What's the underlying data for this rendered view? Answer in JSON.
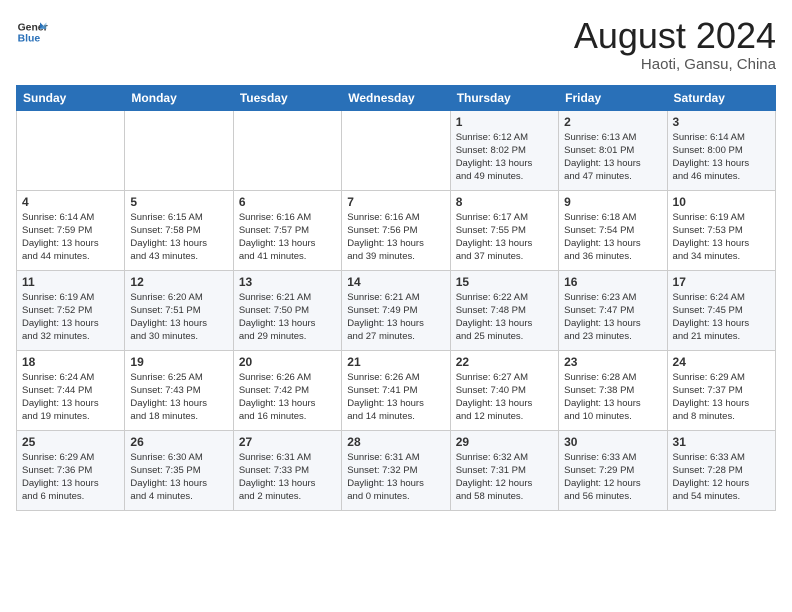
{
  "header": {
    "logo_line1": "General",
    "logo_line2": "Blue",
    "month": "August 2024",
    "location": "Haoti, Gansu, China"
  },
  "weekdays": [
    "Sunday",
    "Monday",
    "Tuesday",
    "Wednesday",
    "Thursday",
    "Friday",
    "Saturday"
  ],
  "weeks": [
    [
      {
        "day": "",
        "info": ""
      },
      {
        "day": "",
        "info": ""
      },
      {
        "day": "",
        "info": ""
      },
      {
        "day": "",
        "info": ""
      },
      {
        "day": "1",
        "info": "Sunrise: 6:12 AM\nSunset: 8:02 PM\nDaylight: 13 hours\nand 49 minutes."
      },
      {
        "day": "2",
        "info": "Sunrise: 6:13 AM\nSunset: 8:01 PM\nDaylight: 13 hours\nand 47 minutes."
      },
      {
        "day": "3",
        "info": "Sunrise: 6:14 AM\nSunset: 8:00 PM\nDaylight: 13 hours\nand 46 minutes."
      }
    ],
    [
      {
        "day": "4",
        "info": "Sunrise: 6:14 AM\nSunset: 7:59 PM\nDaylight: 13 hours\nand 44 minutes."
      },
      {
        "day": "5",
        "info": "Sunrise: 6:15 AM\nSunset: 7:58 PM\nDaylight: 13 hours\nand 43 minutes."
      },
      {
        "day": "6",
        "info": "Sunrise: 6:16 AM\nSunset: 7:57 PM\nDaylight: 13 hours\nand 41 minutes."
      },
      {
        "day": "7",
        "info": "Sunrise: 6:16 AM\nSunset: 7:56 PM\nDaylight: 13 hours\nand 39 minutes."
      },
      {
        "day": "8",
        "info": "Sunrise: 6:17 AM\nSunset: 7:55 PM\nDaylight: 13 hours\nand 37 minutes."
      },
      {
        "day": "9",
        "info": "Sunrise: 6:18 AM\nSunset: 7:54 PM\nDaylight: 13 hours\nand 36 minutes."
      },
      {
        "day": "10",
        "info": "Sunrise: 6:19 AM\nSunset: 7:53 PM\nDaylight: 13 hours\nand 34 minutes."
      }
    ],
    [
      {
        "day": "11",
        "info": "Sunrise: 6:19 AM\nSunset: 7:52 PM\nDaylight: 13 hours\nand 32 minutes."
      },
      {
        "day": "12",
        "info": "Sunrise: 6:20 AM\nSunset: 7:51 PM\nDaylight: 13 hours\nand 30 minutes."
      },
      {
        "day": "13",
        "info": "Sunrise: 6:21 AM\nSunset: 7:50 PM\nDaylight: 13 hours\nand 29 minutes."
      },
      {
        "day": "14",
        "info": "Sunrise: 6:21 AM\nSunset: 7:49 PM\nDaylight: 13 hours\nand 27 minutes."
      },
      {
        "day": "15",
        "info": "Sunrise: 6:22 AM\nSunset: 7:48 PM\nDaylight: 13 hours\nand 25 minutes."
      },
      {
        "day": "16",
        "info": "Sunrise: 6:23 AM\nSunset: 7:47 PM\nDaylight: 13 hours\nand 23 minutes."
      },
      {
        "day": "17",
        "info": "Sunrise: 6:24 AM\nSunset: 7:45 PM\nDaylight: 13 hours\nand 21 minutes."
      }
    ],
    [
      {
        "day": "18",
        "info": "Sunrise: 6:24 AM\nSunset: 7:44 PM\nDaylight: 13 hours\nand 19 minutes."
      },
      {
        "day": "19",
        "info": "Sunrise: 6:25 AM\nSunset: 7:43 PM\nDaylight: 13 hours\nand 18 minutes."
      },
      {
        "day": "20",
        "info": "Sunrise: 6:26 AM\nSunset: 7:42 PM\nDaylight: 13 hours\nand 16 minutes."
      },
      {
        "day": "21",
        "info": "Sunrise: 6:26 AM\nSunset: 7:41 PM\nDaylight: 13 hours\nand 14 minutes."
      },
      {
        "day": "22",
        "info": "Sunrise: 6:27 AM\nSunset: 7:40 PM\nDaylight: 13 hours\nand 12 minutes."
      },
      {
        "day": "23",
        "info": "Sunrise: 6:28 AM\nSunset: 7:38 PM\nDaylight: 13 hours\nand 10 minutes."
      },
      {
        "day": "24",
        "info": "Sunrise: 6:29 AM\nSunset: 7:37 PM\nDaylight: 13 hours\nand 8 minutes."
      }
    ],
    [
      {
        "day": "25",
        "info": "Sunrise: 6:29 AM\nSunset: 7:36 PM\nDaylight: 13 hours\nand 6 minutes."
      },
      {
        "day": "26",
        "info": "Sunrise: 6:30 AM\nSunset: 7:35 PM\nDaylight: 13 hours\nand 4 minutes."
      },
      {
        "day": "27",
        "info": "Sunrise: 6:31 AM\nSunset: 7:33 PM\nDaylight: 13 hours\nand 2 minutes."
      },
      {
        "day": "28",
        "info": "Sunrise: 6:31 AM\nSunset: 7:32 PM\nDaylight: 13 hours\nand 0 minutes."
      },
      {
        "day": "29",
        "info": "Sunrise: 6:32 AM\nSunset: 7:31 PM\nDaylight: 12 hours\nand 58 minutes."
      },
      {
        "day": "30",
        "info": "Sunrise: 6:33 AM\nSunset: 7:29 PM\nDaylight: 12 hours\nand 56 minutes."
      },
      {
        "day": "31",
        "info": "Sunrise: 6:33 AM\nSunset: 7:28 PM\nDaylight: 12 hours\nand 54 minutes."
      }
    ]
  ]
}
